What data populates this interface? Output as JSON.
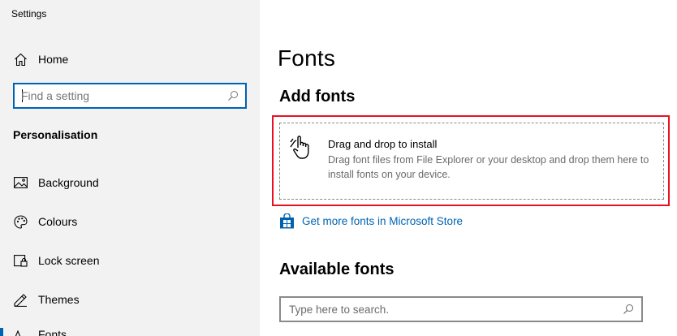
{
  "window": {
    "title": "Settings"
  },
  "sidebar": {
    "home_label": "Home",
    "search_placeholder": "Find a setting",
    "section_title": "Personalisation",
    "items": [
      {
        "label": "Background",
        "icon": "image-icon"
      },
      {
        "label": "Colours",
        "icon": "palette-icon"
      },
      {
        "label": "Lock screen",
        "icon": "lock-screen-icon"
      },
      {
        "label": "Themes",
        "icon": "themes-icon"
      },
      {
        "label": "Fonts",
        "icon": "fonts-icon",
        "selected": true
      }
    ]
  },
  "main": {
    "title": "Fonts",
    "add_fonts": {
      "heading": "Add fonts",
      "drop_title": "Drag and drop to install",
      "drop_description": "Drag font files from File Explorer or your desktop and drop them here to install fonts on your device."
    },
    "store_link": "Get more fonts in Microsoft Store",
    "available_fonts": {
      "heading": "Available fonts",
      "search_placeholder": "Type here to search."
    }
  },
  "colors": {
    "accent": "#0063b1",
    "highlight_border": "#e81123",
    "sidebar_bg": "#f2f2f2"
  }
}
